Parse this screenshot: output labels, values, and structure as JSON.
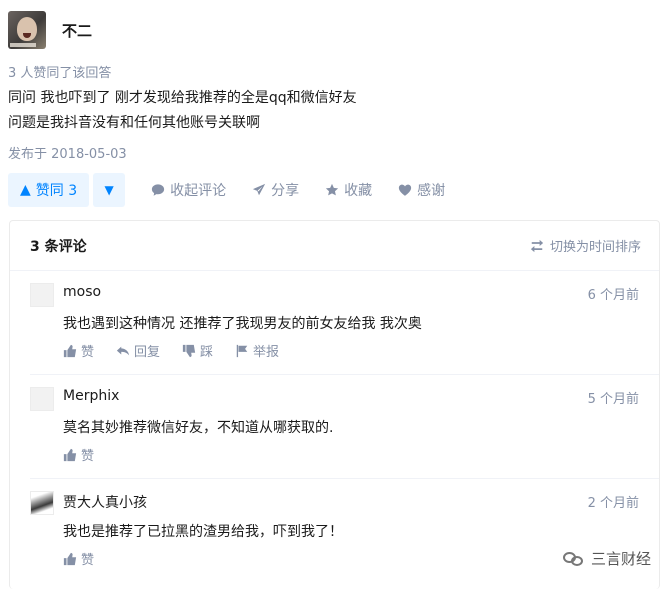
{
  "answer": {
    "author_name": "不二",
    "voters_text": "3 人赞同了该回答",
    "content_lines": [
      "同问 我也吓到了 刚才发现给我推荐的全是qq和微信好友",
      "问题是我抖音没有和任何其他账号关联啊"
    ],
    "published": "发布于 2018-05-03"
  },
  "actions": {
    "vote_up_label": "赞同 3",
    "collapse_comments": "收起评论",
    "share": "分享",
    "favorite": "收藏",
    "thanks": "感谢"
  },
  "comments": {
    "title": "3 条评论",
    "sort_label": "切换为时间排序",
    "items": [
      {
        "name": "moso",
        "time": "6 个月前",
        "text": "我也遇到这种情况 还推荐了我现男友的前女友给我 我次奥",
        "actions": [
          "赞",
          "回复",
          "踩",
          "举报"
        ]
      },
      {
        "name": "Merphix",
        "time": "5 个月前",
        "text": "莫名其妙推荐微信好友，不知道从哪获取的.",
        "actions": [
          "赞"
        ]
      },
      {
        "name": "贾大人真小孩",
        "time": "2 个月前",
        "text": "我也是推荐了已拉黑的渣男给我，吓到我了！",
        "actions": [
          "赞"
        ]
      }
    ]
  },
  "watermark": "三言财经",
  "colors": {
    "accent": "#0084ff",
    "accent_bg": "#ebf5ff",
    "muted": "#8590a6"
  }
}
